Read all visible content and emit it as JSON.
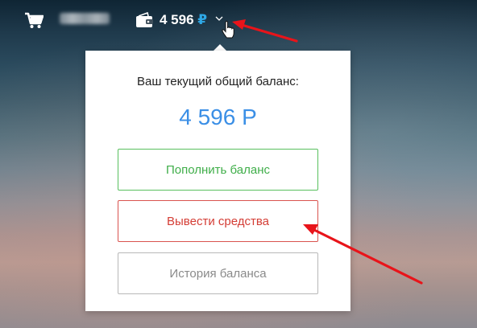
{
  "header": {
    "cart_icon": "shopping-cart-icon",
    "wallet_icon": "wallet-icon",
    "balance_amount": "4 596",
    "balance_currency": "₽",
    "dropdown_icon": "chevron-down-icon"
  },
  "balance_popup": {
    "heading": "Ваш текущий общий баланс:",
    "balance": "4 596 Р",
    "topup_label": "Пополнить баланс",
    "withdraw_label": "Вывести средства",
    "history_label": "История баланса"
  },
  "colors": {
    "balance_accent": "#3b8fe6",
    "currency_accent": "#2ea8e6",
    "topup": "#3fae49",
    "withdraw": "#d43d35",
    "history": "#8a8a8a",
    "annotation_arrow": "#e8141a"
  }
}
